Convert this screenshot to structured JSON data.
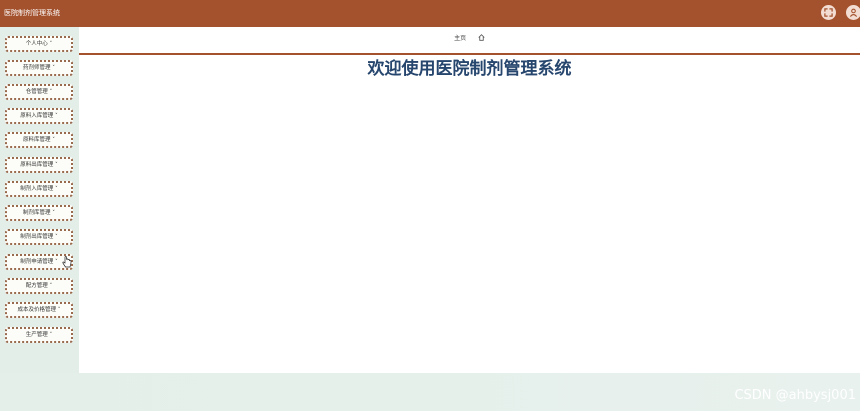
{
  "header": {
    "app_title": "医院制剂管理系统",
    "fullscreen_icon": "fullscreen-icon",
    "user_icon": "user-icon"
  },
  "sidebar": {
    "items": [
      {
        "label": "个人中心 ˅"
      },
      {
        "label": "药剂师管理 ˅"
      },
      {
        "label": "仓管管理 ˅"
      },
      {
        "label": "原料入库管理 ˅"
      },
      {
        "label": "原料库管理 ˅"
      },
      {
        "label": "原料出库管理 ˅"
      },
      {
        "label": "制剂入库管理 ˅"
      },
      {
        "label": "制剂库管理 ˅"
      },
      {
        "label": "制剂出库管理 ˅"
      },
      {
        "label": "制剂申请管理 ˅"
      },
      {
        "label": "配方管理 ˅"
      },
      {
        "label": "成本及价格管理 ˅"
      },
      {
        "label": "生产管理 ˅"
      }
    ]
  },
  "main": {
    "breadcrumb_home": "主页",
    "breadcrumb_icon": "home-icon",
    "welcome": "欢迎使用医院制剂管理系统"
  },
  "footer": {
    "watermark": "CSDN @ahbysj001"
  },
  "colors": {
    "header_bg": "#a4522e",
    "title_text": "#26466e",
    "menu_border": "#9a6a4e"
  }
}
